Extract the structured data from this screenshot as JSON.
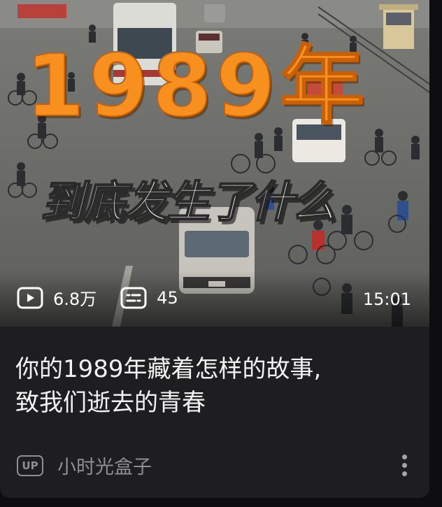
{
  "video": {
    "thumbnail": {
      "overlay_year": "1989年",
      "overlay_subtitle": "到底发生了什么"
    },
    "views": "6.8万",
    "comments": "45",
    "duration": "15:01",
    "title_lines": [
      "你的1989年藏着怎样的故事,",
      "致我们逝去的青春"
    ],
    "author": {
      "badge": "UP",
      "name": "小时光盒子"
    }
  },
  "icons": {
    "views": "play-icon",
    "comments": "danmaku-icon",
    "more": "more-vertical-icon"
  },
  "colors": {
    "overlay_year": "#f7901e",
    "card_background": "#1e1e20",
    "title_text": "#f2f2f2",
    "meta_text": "#8f8f93"
  }
}
